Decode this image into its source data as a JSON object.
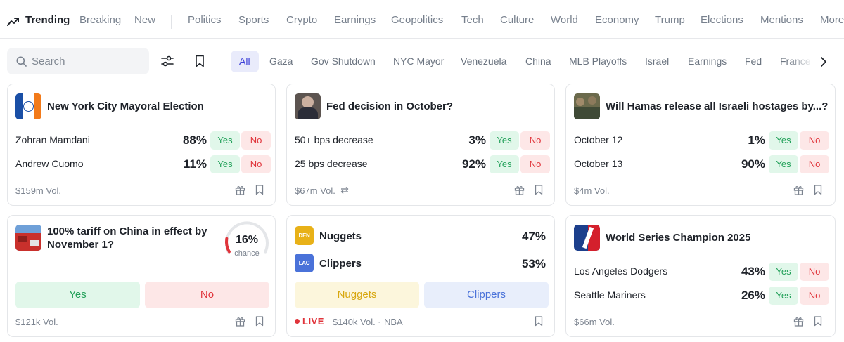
{
  "topnav": {
    "items": [
      "Trending",
      "Breaking",
      "New",
      "Politics",
      "Sports",
      "Crypto",
      "Earnings",
      "Geopolitics",
      "Tech",
      "Culture",
      "World",
      "Economy",
      "Trump",
      "Elections",
      "Mentions",
      "More"
    ],
    "active": "Trending"
  },
  "search": {
    "placeholder": "Search"
  },
  "chips": [
    "All",
    "Gaza",
    "Gov Shutdown",
    "NYC Mayor",
    "Venezuela",
    "China",
    "MLB Playoffs",
    "Israel",
    "Earnings",
    "Fed",
    "France"
  ],
  "colors": {
    "yes": "#23a15a",
    "no": "#e0343b",
    "accent": "#3c3fd8"
  },
  "cards": {
    "nyc": {
      "title": "New York City Mayoral Election",
      "rows": [
        {
          "label": "Zohran Mamdani",
          "pct": "88%",
          "yes": "Yes",
          "no": "No"
        },
        {
          "label": "Andrew Cuomo",
          "pct": "11%",
          "yes": "Yes",
          "no": "No"
        }
      ],
      "vol": "$159m Vol."
    },
    "fed": {
      "title": "Fed decision in October?",
      "rows": [
        {
          "label": "50+ bps decrease",
          "pct": "3%",
          "yes": "Yes",
          "no": "No"
        },
        {
          "label": "25 bps decrease",
          "pct": "92%",
          "yes": "Yes",
          "no": "No"
        }
      ],
      "vol": "$67m Vol."
    },
    "hamas": {
      "title": "Will Hamas release all Israeli hostages by...?",
      "rows": [
        {
          "label": "October 12",
          "pct": "1%",
          "yes": "Yes",
          "no": "No"
        },
        {
          "label": "October 13",
          "pct": "90%",
          "yes": "Yes",
          "no": "No"
        }
      ],
      "vol": "$4m Vol."
    },
    "tariff": {
      "title_line1": "100% tariff on China in effect by",
      "title_line2": "November 1?",
      "chance_value": "16%",
      "chance_fraction": 0.16,
      "chance_label": "chance",
      "yes": "Yes",
      "no": "No",
      "vol": "$121k Vol."
    },
    "game": {
      "team1": {
        "abbr": "DEN",
        "name": "Nuggets",
        "pct": "47%"
      },
      "team2": {
        "abbr": "LAC",
        "name": "Clippers",
        "pct": "53%"
      },
      "btn1": "Nuggets",
      "btn2": "Clippers",
      "live": "LIVE",
      "vol": "$140k Vol.",
      "league": "NBA"
    },
    "ws": {
      "title": "World Series Champion 2025",
      "rows": [
        {
          "label": "Los Angeles Dodgers",
          "pct": "43%",
          "yes": "Yes",
          "no": "No"
        },
        {
          "label": "Seattle Mariners",
          "pct": "26%",
          "yes": "Yes",
          "no": "No"
        }
      ],
      "vol": "$66m Vol."
    }
  }
}
